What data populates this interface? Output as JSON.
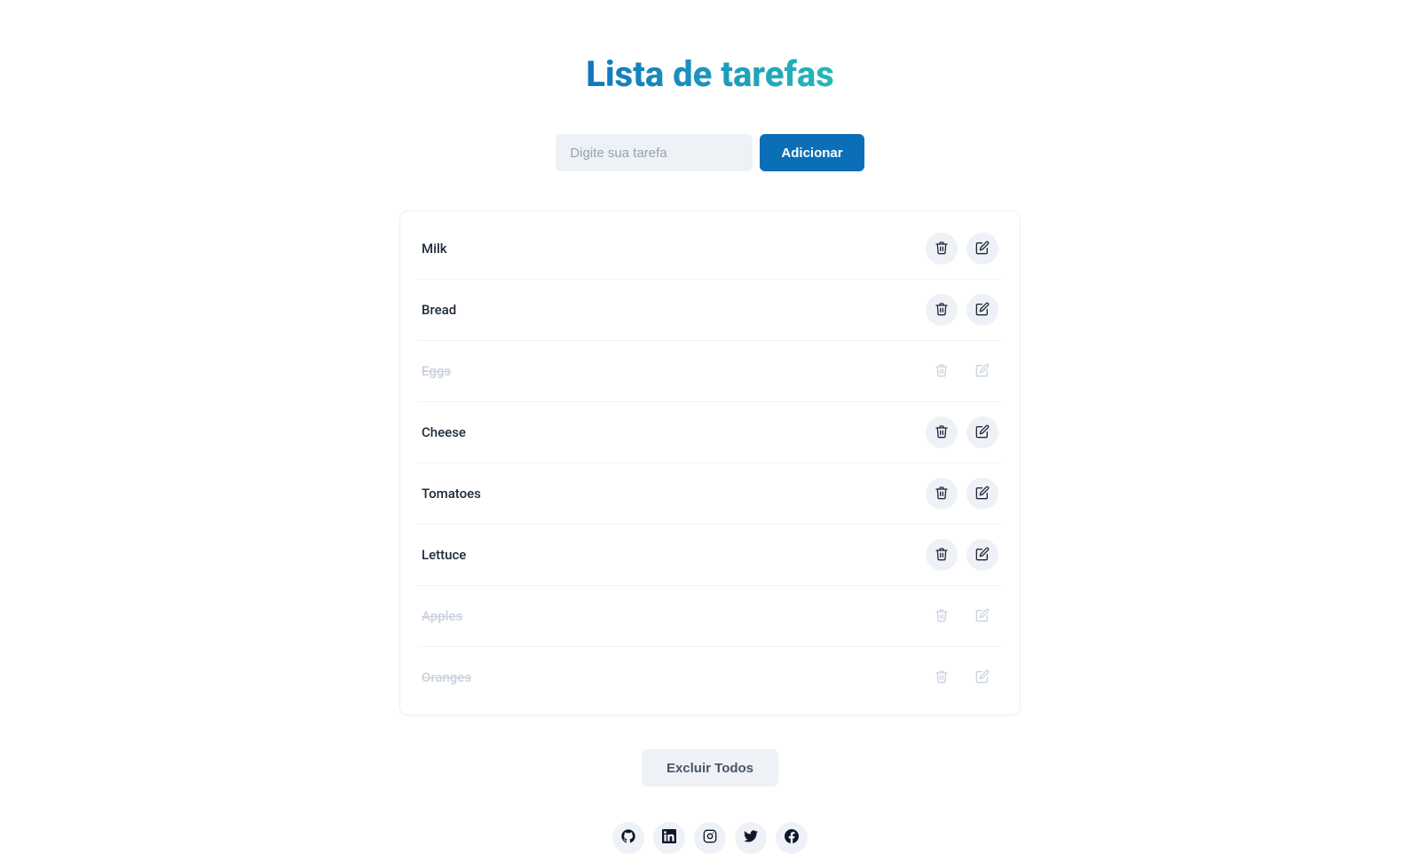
{
  "title": "Lista de tarefas",
  "input": {
    "placeholder": "Digite sua tarefa",
    "value": ""
  },
  "add_button": "Adicionar",
  "tasks": [
    {
      "label": "Milk",
      "completed": false
    },
    {
      "label": "Bread",
      "completed": false
    },
    {
      "label": "Eggs",
      "completed": true
    },
    {
      "label": "Cheese",
      "completed": false
    },
    {
      "label": "Tomatoes",
      "completed": false
    },
    {
      "label": "Lettuce",
      "completed": false
    },
    {
      "label": "Apples",
      "completed": true
    },
    {
      "label": "Oranges",
      "completed": true
    }
  ],
  "delete_all_button": "Excluir Todos",
  "socials": [
    "github",
    "linkedin",
    "instagram",
    "twitter",
    "facebook"
  ]
}
